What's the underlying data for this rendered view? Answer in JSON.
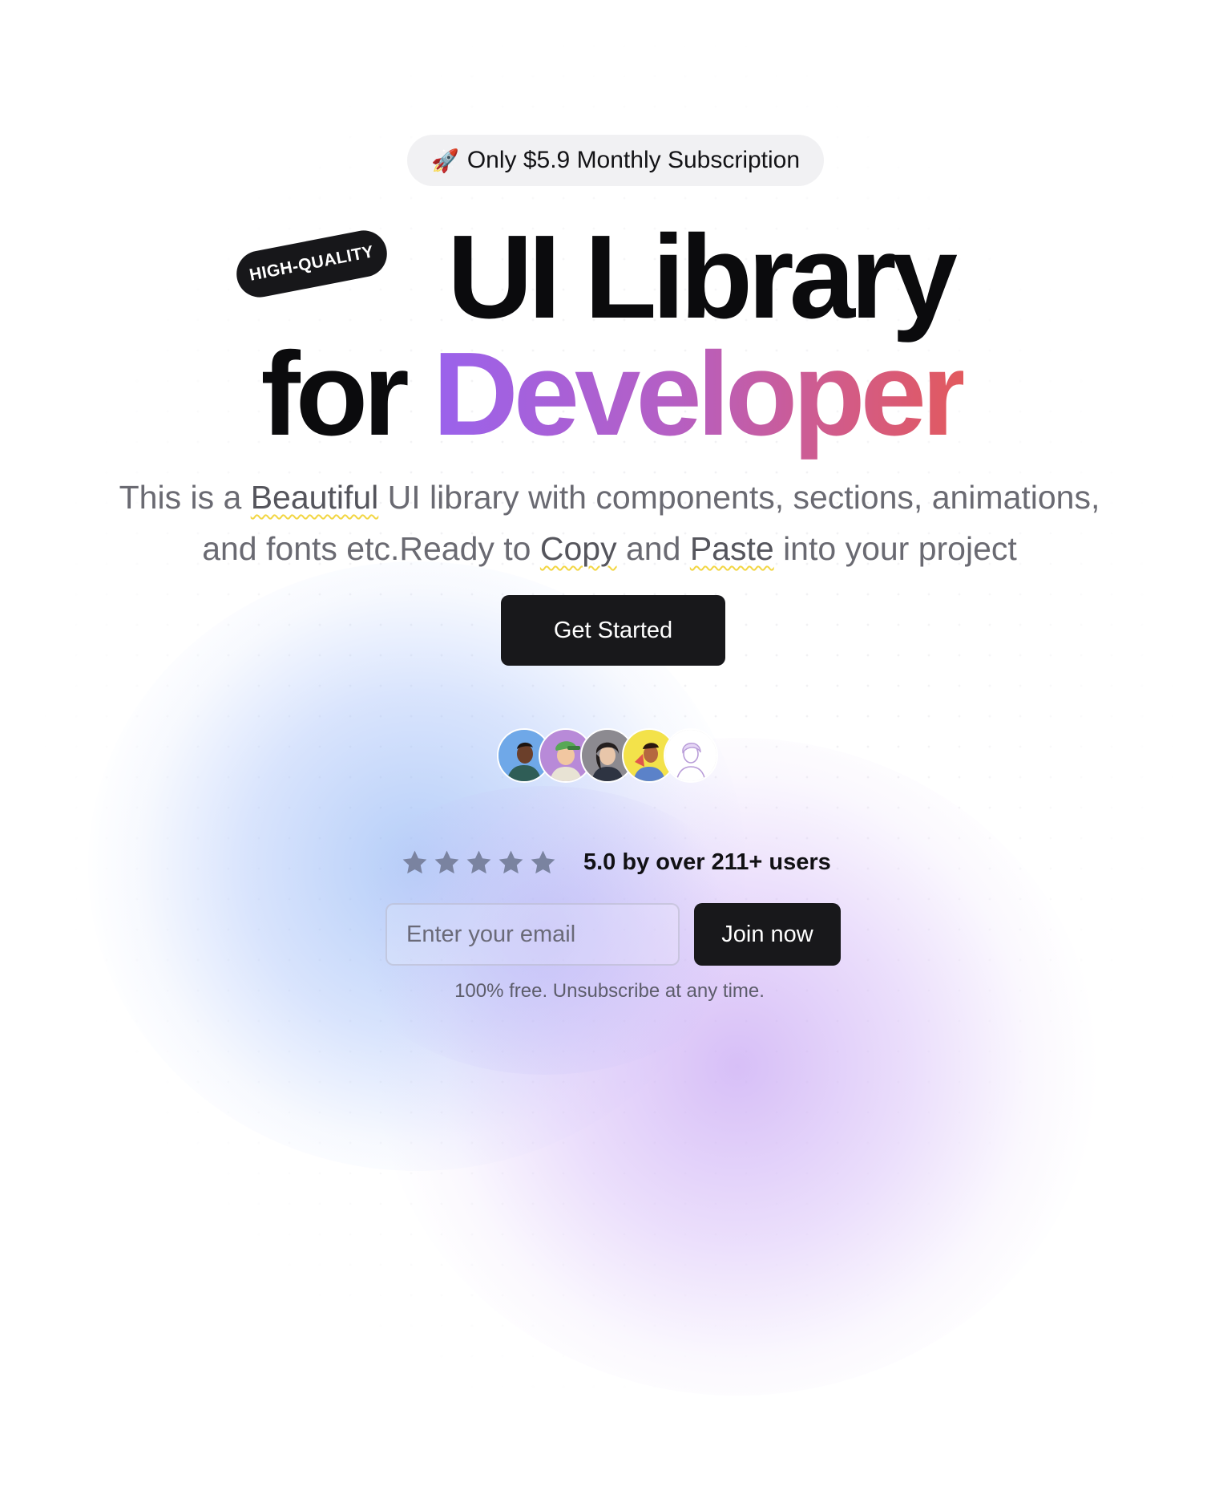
{
  "announcement": {
    "icon": "rocket-icon",
    "text": "Only $5.9 Monthly Subscription"
  },
  "badge": {
    "text": "HIGH-QUALITY"
  },
  "headline": {
    "line1": "UI Library",
    "line2_prefix": "for",
    "line2_highlight": "Developer"
  },
  "description": {
    "part1": "This is a",
    "highlight1": "Beautiful",
    "part2": "UI library with components, sections, animations,",
    "part3": "and fonts etc.Ready to",
    "highlight2": "Copy",
    "part4": "and",
    "highlight3": "Paste",
    "part5": "into your project"
  },
  "cta": {
    "label": "Get Started"
  },
  "avatars": [
    "avatar-1",
    "avatar-2",
    "avatar-3",
    "avatar-4",
    "avatar-5"
  ],
  "rating": {
    "stars": 5,
    "text": "5.0 by over 211+ users"
  },
  "signup": {
    "placeholder": "Enter your email",
    "button_label": "Join now",
    "fineprint": "100% free. Unsubscribe at any time."
  },
  "colors": {
    "primary": "#18181b",
    "gradient_start": "#9a62ec",
    "gradient_end": "#e25a5e",
    "star": "#7a83a0",
    "squiggle": "#f2d643"
  }
}
